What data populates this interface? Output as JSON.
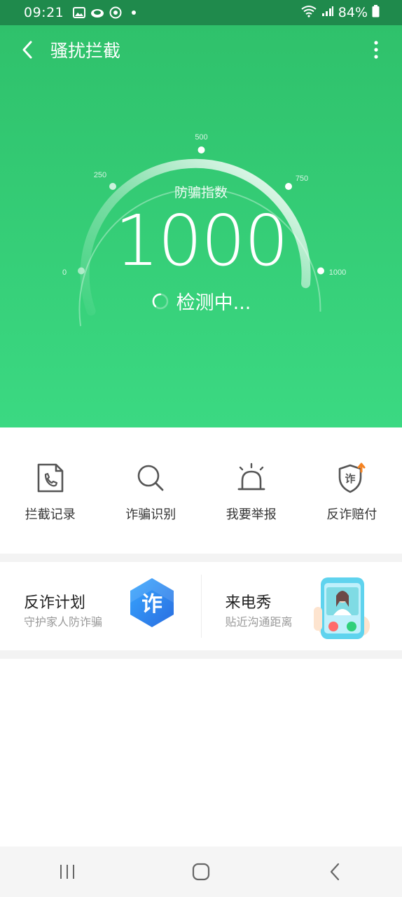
{
  "status_bar": {
    "time": "09:21",
    "battery": "84%",
    "icons": [
      "image-icon",
      "cloud-icon",
      "target-icon",
      "dot-icon",
      "wifi-icon",
      "signal-icon",
      "battery-icon"
    ]
  },
  "header": {
    "title": "骚扰拦截",
    "back_icon": "chevron-left-icon",
    "more_icon": "more-vertical-icon"
  },
  "gauge": {
    "label": "防骗指数",
    "value": "1000",
    "ticks": [
      "0",
      "250",
      "500",
      "750",
      "1000"
    ],
    "status": "检测中...",
    "max": 1000,
    "current": 1000
  },
  "actions": [
    {
      "label": "拦截记录",
      "icon": "call-log-icon"
    },
    {
      "label": "诈骗识别",
      "icon": "search-icon"
    },
    {
      "label": "我要举报",
      "icon": "alarm-icon"
    },
    {
      "label": "反诈赔付",
      "icon": "shield-icon",
      "icon_text": "诈"
    }
  ],
  "promos": [
    {
      "title": "反诈计划",
      "subtitle": "守护家人防诈骗",
      "icon": "anti-fraud-hexagon-icon",
      "icon_text": "诈"
    },
    {
      "title": "来电秀",
      "subtitle": "贴近沟通距离",
      "icon": "phone-video-icon"
    }
  ],
  "colors": {
    "primary": "#2fc16b",
    "primary_light": "#3bd982",
    "status_bar": "#1f8a4c",
    "accent_orange": "#f58220",
    "accent_blue": "#2d8cf0"
  },
  "navbar": {
    "icons": [
      "recent-apps-icon",
      "home-icon",
      "back-icon"
    ]
  }
}
